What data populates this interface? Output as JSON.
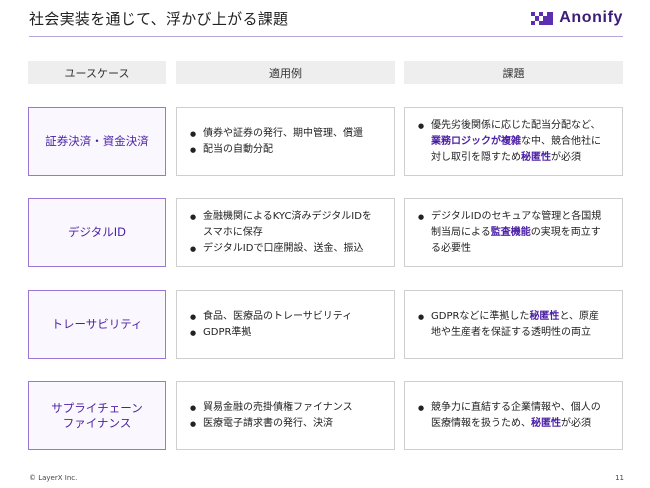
{
  "slide": {
    "title": "社会実装を通じて、浮かび上がる課題",
    "logo_text": "Anonify",
    "footer_copyright": "© LayerX Inc.",
    "page_number": "11",
    "accent_color": "#4b1fa4"
  },
  "columns": [
    "ユースケース",
    "適用例",
    "課題"
  ],
  "rows": [
    {
      "label": "証券決済・資金決済",
      "examples": [
        [
          {
            "t": "債券や証券の発行、期中管理、償還"
          }
        ],
        [
          {
            "t": "配当の自動分配"
          }
        ]
      ],
      "issues": [
        [
          {
            "t": "優先劣後関係に応じた配当分配など、"
          },
          {
            "t": "業務ロジックが複雑",
            "hl": true
          },
          {
            "t": "な中、競合他社に対し取引を隠すため"
          },
          {
            "t": "秘匿性",
            "hl": true
          },
          {
            "t": "が必須"
          }
        ]
      ]
    },
    {
      "label": "デジタルID",
      "examples": [
        [
          {
            "t": "金融機関によるKYC済みデジタルIDをスマホに保存"
          }
        ],
        [
          {
            "t": "デジタルIDで口座開設、送金、振込"
          }
        ]
      ],
      "issues": [
        [
          {
            "t": "デジタルIDのセキュアな管理と各国規制当局による"
          },
          {
            "t": "監査機能",
            "hl": true
          },
          {
            "t": "の実現を両立する必要性"
          }
        ]
      ]
    },
    {
      "label": "トレーサビリティ",
      "examples": [
        [
          {
            "t": "食品、医療品のトレーサビリティ"
          }
        ],
        [
          {
            "t": "GDPR準拠"
          }
        ]
      ],
      "issues": [
        [
          {
            "t": "GDPRなどに準拠した"
          },
          {
            "t": "秘匿性",
            "hl": true
          },
          {
            "t": "と、原産地や生産者を保証する透明性の両立"
          }
        ]
      ]
    },
    {
      "label": "サプライチェーンファイナンス",
      "examples": [
        [
          {
            "t": "貿易金融の売掛債権ファイナンス"
          }
        ],
        [
          {
            "t": "医療電子請求書の発行、決済"
          }
        ]
      ],
      "issues": [
        [
          {
            "t": "競争力に直結する企業情報や、個人の医療情報を扱うため、"
          },
          {
            "t": "秘匿性",
            "hl": true
          },
          {
            "t": "が必須"
          }
        ]
      ]
    }
  ]
}
